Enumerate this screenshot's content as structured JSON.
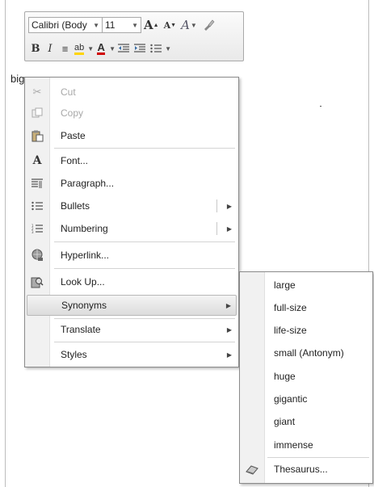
{
  "document": {
    "selected_word": "big"
  },
  "mini_toolbar": {
    "font_name": "Calibri (Body",
    "font_size": "11",
    "grow_font": "A",
    "shrink_font": "A",
    "styles_glyph": "A",
    "bold": "B",
    "italic": "I",
    "highlight": "ab",
    "font_color": "A"
  },
  "context_menu": {
    "items": [
      {
        "label": "Cut",
        "icon": "scissors-icon",
        "enabled": false
      },
      {
        "label": "Copy",
        "icon": "copy-icon",
        "enabled": false
      },
      {
        "label": "Paste",
        "icon": "paste-icon",
        "enabled": true
      },
      {
        "label": "Font...",
        "icon": "font-icon",
        "enabled": true
      },
      {
        "label": "Paragraph...",
        "icon": "paragraph-icon",
        "enabled": true
      },
      {
        "label": "Bullets",
        "icon": "bullets-icon",
        "enabled": true,
        "submenu": true
      },
      {
        "label": "Numbering",
        "icon": "numbering-icon",
        "enabled": true,
        "submenu": true
      },
      {
        "label": "Hyperlink...",
        "icon": "hyperlink-icon",
        "enabled": true
      },
      {
        "label": "Look Up...",
        "icon": "lookup-icon",
        "enabled": true
      },
      {
        "label": "Synonyms",
        "icon": "",
        "enabled": true,
        "submenu": true,
        "highlighted": true
      },
      {
        "label": "Translate",
        "icon": "",
        "enabled": true,
        "submenu": true
      },
      {
        "label": "Styles",
        "icon": "",
        "enabled": true,
        "submenu": true
      }
    ]
  },
  "synonyms_submenu": {
    "items": [
      "large",
      "full-size",
      "life-size",
      "small (Antonym)",
      "huge",
      "gigantic",
      "giant",
      "immense"
    ],
    "thesaurus_label": "Thesaurus..."
  },
  "colors": {
    "font_color_bar": "#d00000",
    "highlight_bar": "#ffd400"
  }
}
